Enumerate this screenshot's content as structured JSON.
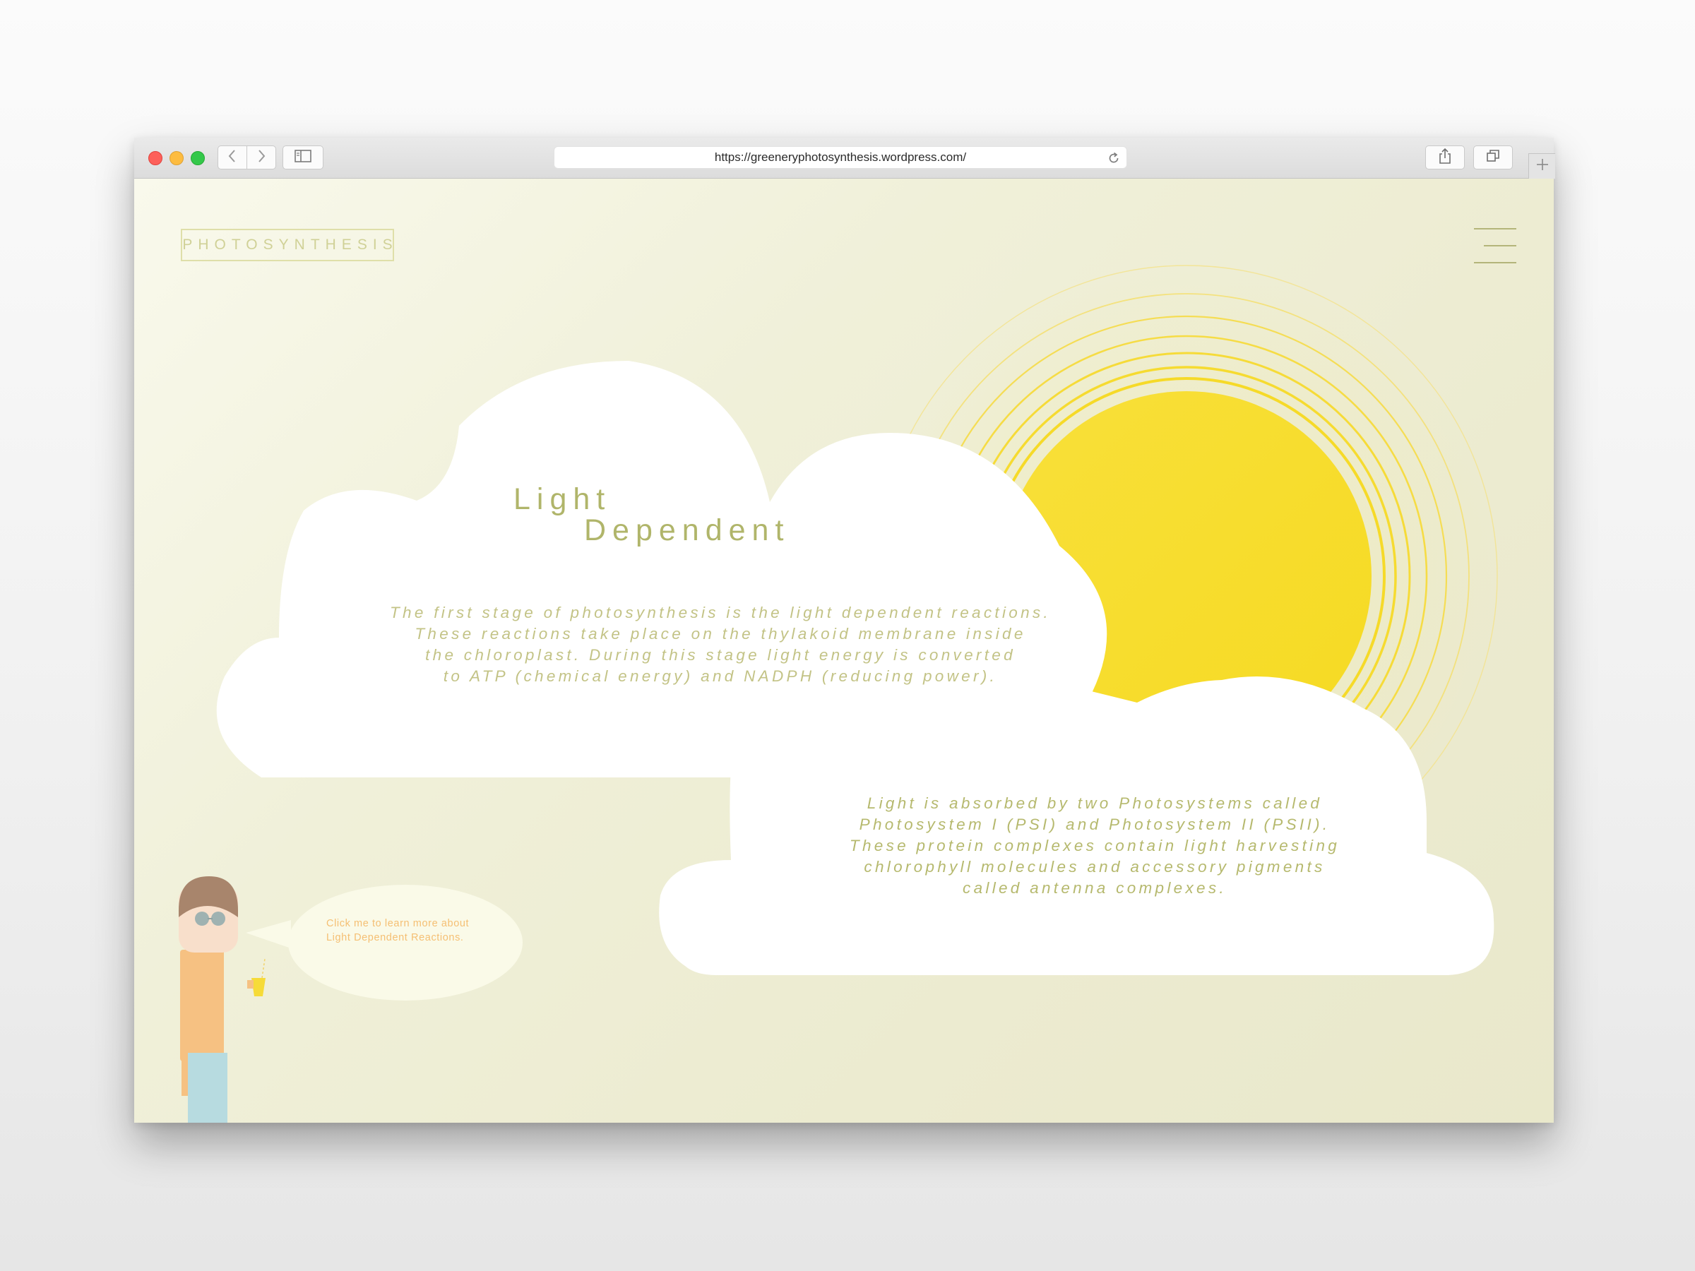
{
  "browser": {
    "url": "https://greeneryphotosynthesis.wordpress.com/",
    "colors": {
      "close": "#fd605a",
      "minimize": "#fdbc40",
      "zoom": "#34c84a"
    }
  },
  "site": {
    "logo": "PHOTOSYNTHESIS",
    "title_line1": "Light",
    "title_line2": "Dependent",
    "paragraph1": [
      "The first stage of photosynthesis is the light dependent reactions.",
      "These reactions take place on the thylakoid membrane inside",
      "the chloroplast. During this stage light energy is converted",
      "to ATP (chemical energy) and NADPH (reducing power)."
    ],
    "paragraph2": [
      "Light is absorbed by two Photosystems called",
      "Photosystem I (PSI) and Photosystem II (PSII).",
      "These protein complexes contain light harvesting",
      "chlorophyll molecules and accessory pigments",
      "called antenna complexes."
    ],
    "speech_bubble": [
      "Click me to learn more about",
      "Light Dependent Reactions."
    ],
    "colors": {
      "accent_green": "#b0b56a",
      "sun_yellow": "#f7dd2a",
      "bubble_orange": "#f5bf73",
      "background": "#f0f0d9"
    }
  }
}
